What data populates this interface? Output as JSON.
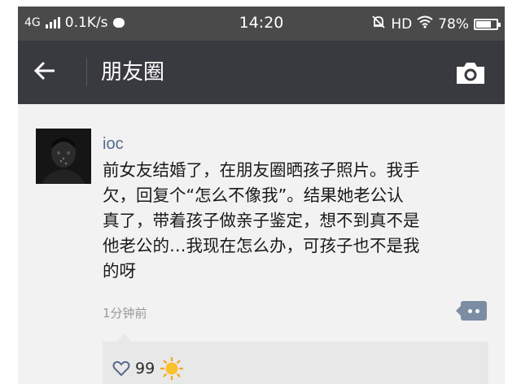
{
  "status_bar": {
    "network": "4G",
    "speed": "0.1K/s",
    "time": "14:20",
    "hd": "HD",
    "battery": "78%",
    "icons": [
      "signal-bars-icon",
      "chat-icon",
      "mute-bell-icon",
      "wifi-icon",
      "battery-icon"
    ]
  },
  "nav": {
    "back_icon": "arrow-left-icon",
    "title": "朋友圈",
    "camera_icon": "camera-icon"
  },
  "post": {
    "author": "ioc",
    "text": "前女友结婚了，在朋友圈晒孩子照片。我手\n欠，回复个“怎么不像我”。结果她老公认\n真了，带着孩子做亲子鉴定，想不到真不是\n他老公的…我现在怎么办，可孩子也不是我\n的呀",
    "time": "1分钟前",
    "comment_icon": "comment-dots-icon",
    "likes": {
      "count": "99",
      "icons": [
        "heart-icon",
        "sun-emoji-icon"
      ]
    }
  },
  "colors": {
    "status_bar_bg": "#4a4a4a",
    "nav_bg": "#393a3f",
    "author": "#56688c",
    "page_bg": "#f2f2f2"
  }
}
